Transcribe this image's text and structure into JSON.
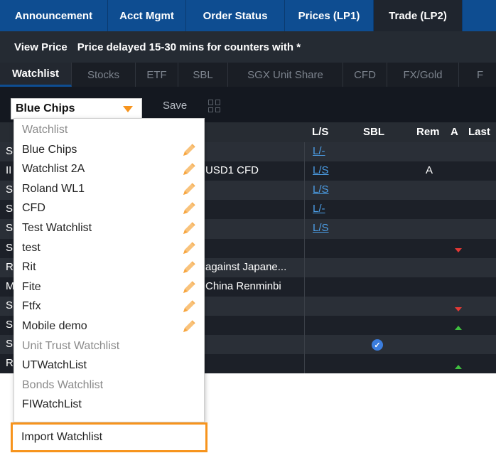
{
  "top_tabs": [
    "Announcement",
    "Acct Mgmt",
    "Order Status",
    "Prices (LP1)",
    "Trade (LP2)"
  ],
  "info": {
    "view_price": "View Price",
    "message": "Price delayed 15-30 mins for counters with *"
  },
  "sub_tabs": [
    "Watchlist",
    "Stocks",
    "ETF",
    "SBL",
    "SGX Unit Share",
    "CFD",
    "FX/Gold",
    "F"
  ],
  "toolbar": {
    "selected": "Blue Chips",
    "save": "Save"
  },
  "columns": {
    "ls": "L/S",
    "sbl": "SBL",
    "rem": "Rem",
    "a": "A",
    "last": "Last"
  },
  "rows": [
    {
      "lead": "S",
      "ls": "L/-"
    },
    {
      "lead": "II",
      "name": "USD1 CFD",
      "ls": "L/S",
      "rem": "A"
    },
    {
      "lead": "S",
      "ls": "L/S"
    },
    {
      "lead": "S",
      "ls": "L/-"
    },
    {
      "lead": "S",
      "ls": "L/S"
    },
    {
      "lead": "S"
    },
    {
      "lead": "R",
      "name": "against Japane..."
    },
    {
      "lead": "M",
      "name": "China Renminbi"
    },
    {
      "lead": "S"
    },
    {
      "lead": "S"
    },
    {
      "lead": "S"
    },
    {
      "lead": "R"
    }
  ],
  "dropdown": {
    "items": [
      {
        "label": "Watchlist",
        "group": true
      },
      {
        "label": "Blue Chips",
        "edit": true
      },
      {
        "label": "Watchlist 2A",
        "edit": true
      },
      {
        "label": "Roland WL1",
        "edit": true
      },
      {
        "label": "CFD",
        "edit": true
      },
      {
        "label": "Test Watchlist",
        "edit": true
      },
      {
        "label": "test",
        "edit": true
      },
      {
        "label": "Rit",
        "edit": true
      },
      {
        "label": "Fite",
        "edit": true
      },
      {
        "label": "Ftfx",
        "edit": true
      },
      {
        "label": "Mobile demo",
        "edit": true
      },
      {
        "label": "Unit Trust Watchlist",
        "group": true
      },
      {
        "label": "UTWatchList"
      },
      {
        "label": "Bonds Watchlist",
        "group": true
      },
      {
        "label": "FIWatchList"
      }
    ],
    "import": "Import Watchlist"
  },
  "colors": {
    "header_blue": "#0e4d91",
    "orange": "#f7941d",
    "link_blue": "#4c9fe8"
  }
}
